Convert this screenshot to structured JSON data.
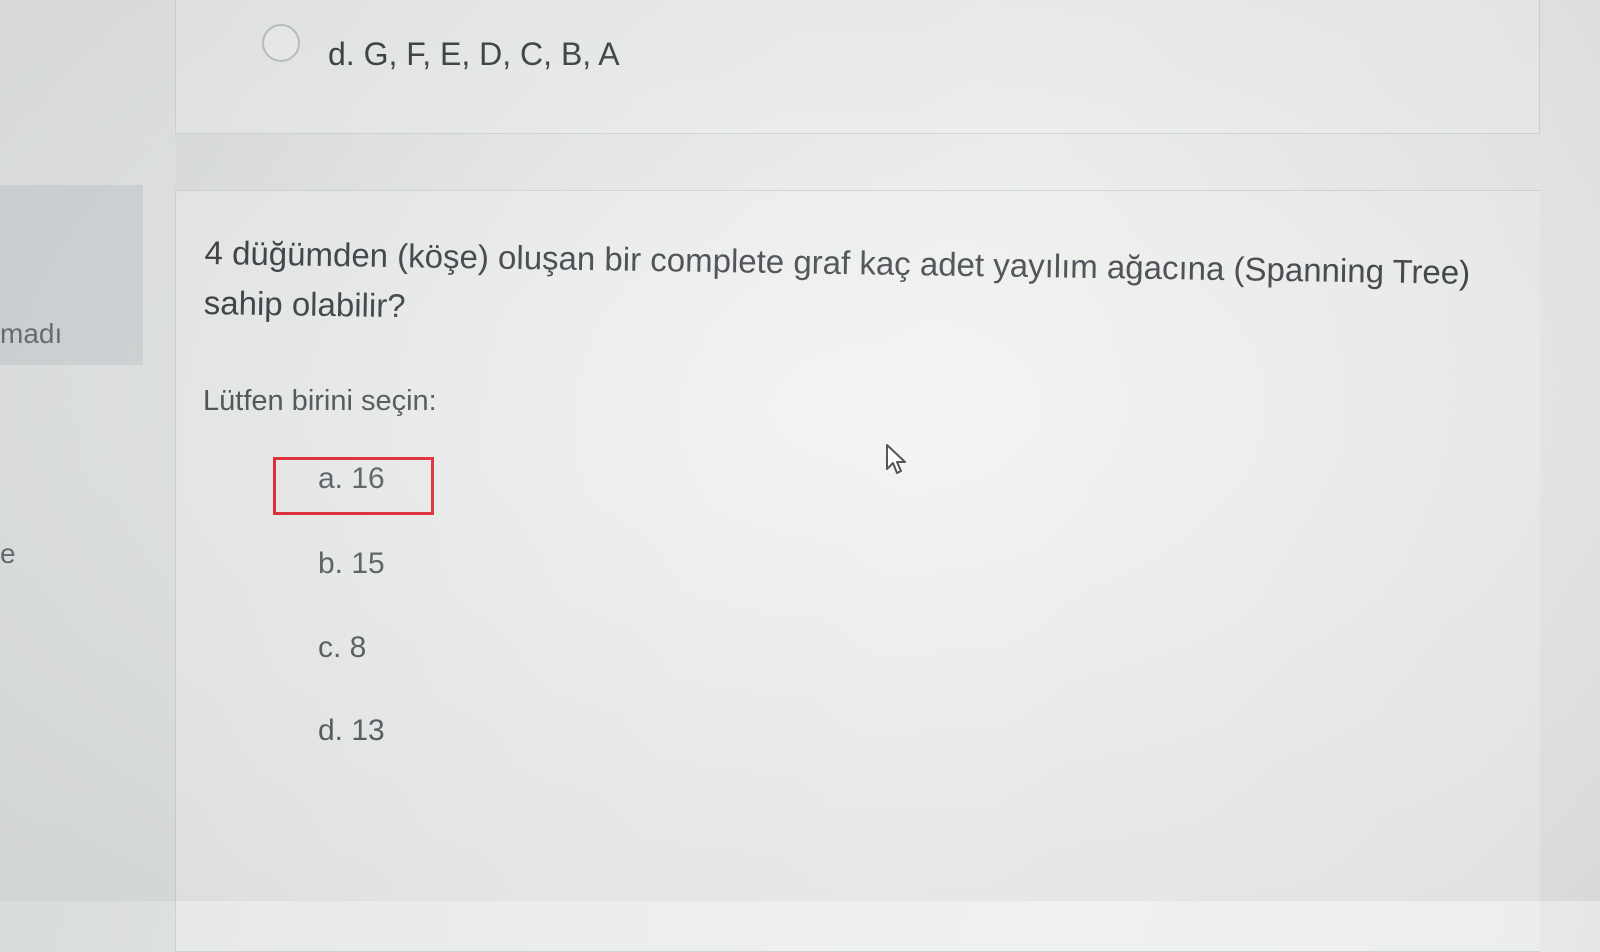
{
  "sidebar": {
    "text_top": "madı",
    "text_bottom": "e"
  },
  "previous_question": {
    "last_option": "d. G, F, E, D, C, B, A"
  },
  "question": {
    "text": "4 düğümden (köşe) oluşan bir complete graf kaç adet yayılım ağacına (Spanning Tree) sahip olabilir?",
    "prompt": "Lütfen birini seçin:",
    "options": [
      {
        "label": "a. 16",
        "highlighted": true
      },
      {
        "label": "b. 15",
        "highlighted": false
      },
      {
        "label": "c. 8",
        "highlighted": false
      },
      {
        "label": "d. 13",
        "highlighted": false
      }
    ]
  },
  "colors": {
    "highlight": "#e0141e",
    "text": "#2a2f34"
  },
  "icons": {
    "cursor": "mouse-pointer-icon",
    "radio": "radio-circle-icon"
  }
}
